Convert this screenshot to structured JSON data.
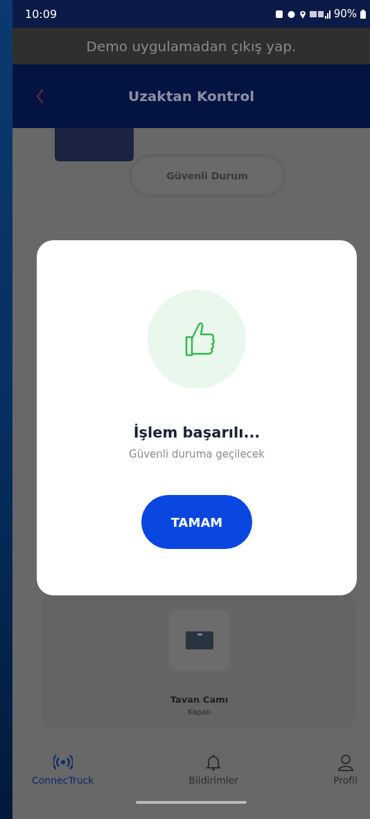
{
  "status_bar": {
    "time": "10:09",
    "battery": "90%"
  },
  "demo_banner": {
    "text": "Demo uygulamadan çıkış yap."
  },
  "header": {
    "title": "Uzaktan Kontrol"
  },
  "content": {
    "mode_button": "Güvenli Durum",
    "tile": {
      "label": "Tavan Camı",
      "status": "Kapalı"
    }
  },
  "dialog": {
    "title": "İşlem başarılı...",
    "message": "Güvenli duruma geçilecek",
    "button": "TAMAM"
  },
  "nav": [
    {
      "kind": "signal",
      "label": "ConnecTruck",
      "selected": true
    },
    {
      "kind": "bell",
      "label": "Bildirimler",
      "selected": false
    },
    {
      "kind": "user",
      "label": "Profil",
      "selected": false
    }
  ]
}
